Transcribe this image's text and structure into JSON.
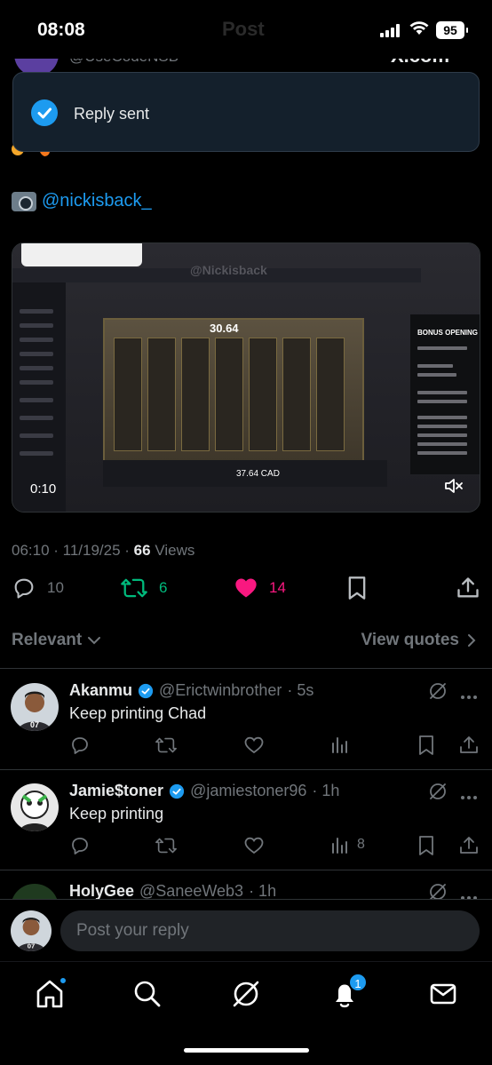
{
  "status_bar": {
    "time": "08:08",
    "battery": "95",
    "ghost_title": "Post"
  },
  "post": {
    "author_handle": "@UseCodeNSB",
    "brand_watermark": "X.com",
    "credit_handle": "@nickisback_",
    "video": {
      "timestamp": "0:10",
      "watermark": "@Nickisback",
      "panel_title": "BONUS OPENING",
      "bet_total": "37.64 CAD",
      "win_display": "30.64"
    },
    "timestamp": "06:10 · 11/19/25 · ",
    "views_count": "66",
    "views_label": " Views",
    "actions": {
      "replies": "10",
      "reposts": "6",
      "likes": "14"
    }
  },
  "toast": {
    "message": "Reply sent"
  },
  "sort": {
    "relevant_label": "Relevant",
    "view_quotes_label": "View quotes"
  },
  "replies": [
    {
      "name": "Akanmu",
      "handle": "@Erictwinbrother",
      "time": "· 5s",
      "text": "Keep printing Chad",
      "views": ""
    },
    {
      "name": "Jamie$toner",
      "handle": "@jamiestoner96",
      "time": "· 1h",
      "text": "Keep printing",
      "views": "8"
    },
    {
      "name": "HolyGee",
      "handle": "@SaneeWeb3",
      "time": "· 1h",
      "text": "",
      "views": ""
    }
  ],
  "composer": {
    "placeholder": "Post your reply"
  },
  "tabbar": {
    "notifications_count": "1"
  },
  "colors": {
    "accent": "#1d9bf0",
    "repost": "#00ba7c",
    "like": "#f91880",
    "muted": "#71767b"
  }
}
